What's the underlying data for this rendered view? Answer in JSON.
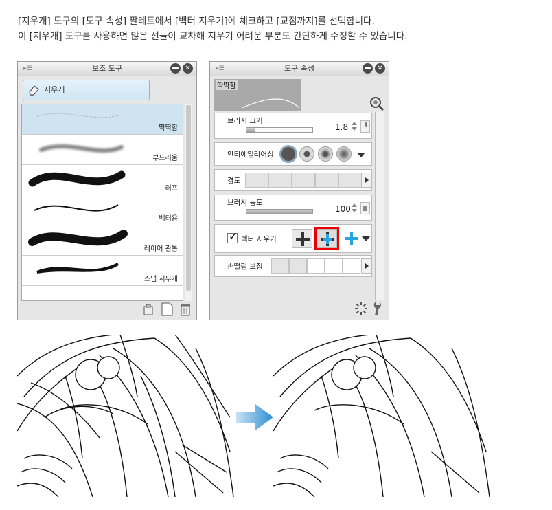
{
  "intro": {
    "line1": "[지우개] 도구의 [도구 속성] 팔레트에서 [벡터 지우기]에 체크하고 [교점까지]를 선택합니다.",
    "line2": "이 [지우개] 도구를 사용하면 많은 선들이 교차해 지우기 어려운 부분도 간단하게 수정할 수 있습니다."
  },
  "sub_tool": {
    "title": "보조 도구",
    "group_label": "지우개",
    "items": [
      {
        "label": "딱딱함"
      },
      {
        "label": "부드러움"
      },
      {
        "label": "러프"
      },
      {
        "label": "벡터용"
      },
      {
        "label": "레이어 관통"
      },
      {
        "label": "스냅 지우개"
      }
    ],
    "selected_index": 0
  },
  "tool_property": {
    "title": "도구 속성",
    "preview_label": "딱딱함",
    "brush_size_label": "브러시 크기",
    "brush_size_value": "1.8",
    "brush_size_fraction": 0.12,
    "antialias_label": "안티에일리어싱",
    "hardness_label": "경도",
    "brush_density_label": "브러시 농도",
    "brush_density_value": "100",
    "brush_density_fraction": 1.0,
    "vector_erase_label": "벡터 지우기",
    "vector_erase_checked": true,
    "stabilization_label": "손떨림 보정"
  },
  "colors": {
    "accent_blue": "#29a3e0",
    "highlight_red": "#e00000",
    "selection": "#cfe4f0"
  }
}
